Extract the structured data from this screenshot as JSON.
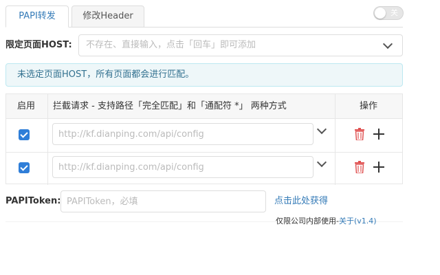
{
  "tabs": [
    {
      "label": "PAPI转发",
      "active": true
    },
    {
      "label": "修改Header",
      "active": false
    }
  ],
  "toggle": {
    "label": "关",
    "on": false
  },
  "host": {
    "label": "限定页面HOST:",
    "placeholder": "不存在、直接输入，点击「回车」即可添加"
  },
  "alert": {
    "text": "未选定页面HOST，所有页面都会进行匹配。"
  },
  "table": {
    "headers": {
      "enable": "启用",
      "rule": "拦截请求 - 支持路径「完全匹配」和「通配符 *」 两种方式",
      "action": "操作"
    },
    "rows": [
      {
        "enabled": true,
        "value": "",
        "placeholder": "http://kf.dianping.com/api/config"
      },
      {
        "enabled": true,
        "value": "",
        "placeholder": "http://kf.dianping.com/api/config"
      }
    ]
  },
  "token": {
    "label": "PAPIToken:",
    "placeholder": "PAPIToken，必填",
    "link": "点击此处获得"
  },
  "footer": {
    "text": "仅限公司内部使用-",
    "about": "关于(v1.4)"
  },
  "colors": {
    "accent": "#337ab7",
    "checkbox": "#2f7ed8",
    "alert_bg": "#eef7f9",
    "trash": "#e05252"
  }
}
